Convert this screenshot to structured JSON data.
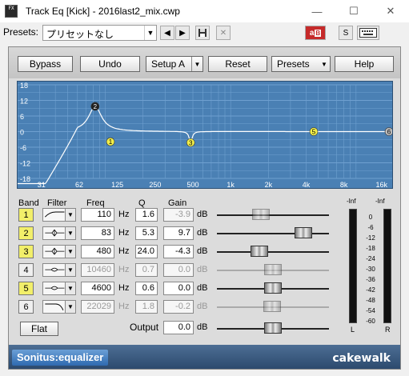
{
  "window": {
    "icon_text": "FX",
    "title": "Track Eq [Kick] - 2016last2_mix.cwp",
    "minimize_glyph": "—",
    "maximize_glyph": "☐",
    "close_glyph": "✕"
  },
  "presets_bar": {
    "label": "Presets:",
    "value": "プリセットなし",
    "icons": [
      "chevron-down-icon",
      "prev-icon",
      "next-icon",
      "save-icon",
      "delete-icon",
      "ab-compare-icon",
      "s-icon",
      "keyboard-icon"
    ],
    "ab_label": "a",
    "s_label": "S"
  },
  "toolbar": {
    "bypass": "Bypass",
    "undo": "Undo",
    "setup": "Setup A",
    "reset": "Reset",
    "presets": "Presets",
    "help": "Help"
  },
  "graph": {
    "y_labels": [
      "18",
      "12",
      "6",
      "0",
      "-6",
      "-12",
      "-18"
    ],
    "x_labels": [
      "31",
      "62",
      "125",
      "250",
      "500",
      "1k",
      "2k",
      "4k",
      "8k",
      "16k"
    ],
    "y_range": [
      -18,
      18
    ],
    "x_range_hz": [
      20,
      20000
    ],
    "band_markers": [
      {
        "label": "1",
        "freq_hz": 110,
        "gain_db": -3.9,
        "active": true
      },
      {
        "label": "2",
        "freq_hz": 83,
        "gain_db": 9.7,
        "active": true
      },
      {
        "label": "3",
        "freq_hz": 480,
        "gain_db": -4.3,
        "active": true
      },
      {
        "label": "5",
        "freq_hz": 4600,
        "gain_db": 0.0,
        "active": true
      },
      {
        "label": "6",
        "freq_hz": 22029,
        "gain_db": 0.0,
        "active": false
      }
    ],
    "colors": {
      "background": "#4a80b4",
      "grid": "#6fa0d0",
      "curve": "#ffffff",
      "marker": "#f2ef4a"
    }
  },
  "bands": {
    "headers": {
      "band": "Band",
      "filter": "Filter",
      "freq": "Freq",
      "q": "Q",
      "gain": "Gain"
    },
    "hz_unit": "Hz",
    "db_unit": "dB",
    "rows": [
      {
        "band": "1",
        "active": true,
        "filter_icon": "low-shelf-icon",
        "freq": "110",
        "q": "1.6",
        "gain": "-3.9",
        "gain_db": -3.9
      },
      {
        "band": "2",
        "active": true,
        "filter_icon": "peak-icon",
        "freq": "83",
        "q": "5.3",
        "gain": "9.7",
        "gain_db": 9.7
      },
      {
        "band": "3",
        "active": true,
        "filter_icon": "peak-icon",
        "freq": "480",
        "q": "24.0",
        "gain": "-4.3",
        "gain_db": -4.3
      },
      {
        "band": "4",
        "active": false,
        "filter_icon": "notch-icon",
        "freq": "10460",
        "q": "0.7",
        "gain": "0.0",
        "gain_db": 0.0
      },
      {
        "band": "5",
        "active": true,
        "filter_icon": "notch-icon",
        "freq": "4600",
        "q": "0.6",
        "gain": "0.0",
        "gain_db": 0.0
      },
      {
        "band": "6",
        "active": false,
        "filter_icon": "high-cut-icon",
        "freq": "22029",
        "q": "1.8",
        "gain": "-0.2",
        "gain_db": -0.2
      }
    ],
    "flat": "Flat",
    "output_label": "Output",
    "output_value": "0.0",
    "output_db": 0.0
  },
  "meter": {
    "left_peak": "-Inf",
    "right_peak": "-Inf",
    "scale": [
      "0",
      "-6",
      "-12",
      "-18",
      "-24",
      "-30",
      "-36",
      "-42",
      "-48",
      "-54",
      "-60"
    ],
    "left_label": "L",
    "right_label": "R"
  },
  "brand": {
    "product": "Sonitus:equalizer",
    "company": "cakewalk"
  }
}
